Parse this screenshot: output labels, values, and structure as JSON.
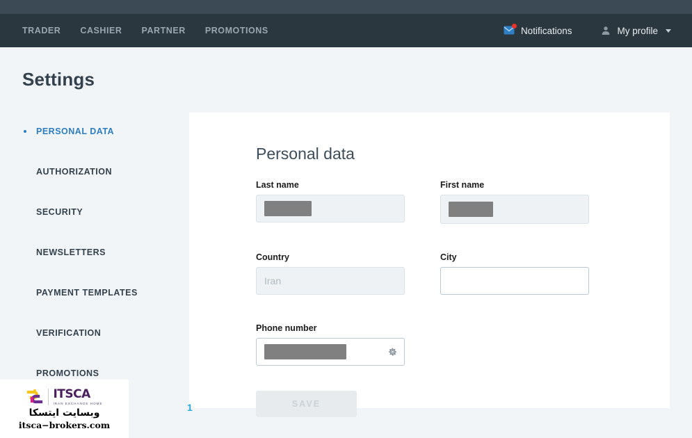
{
  "navbar": {
    "links": [
      {
        "label": "TRADER"
      },
      {
        "label": "CASHIER"
      },
      {
        "label": "PARTNER"
      },
      {
        "label": "PROMOTIONS"
      }
    ],
    "notifications": {
      "label": "Notifications",
      "icon": "envelope-icon",
      "has_unread_badge": true,
      "badge_color": "#e8322a"
    },
    "profile": {
      "label": "My profile",
      "icon": "user-icon",
      "chevron": "chevron-down-icon"
    }
  },
  "page": {
    "title": "Settings"
  },
  "sidebar": {
    "items": [
      {
        "label": "PERSONAL DATA",
        "active": true
      },
      {
        "label": "AUTHORIZATION",
        "active": false
      },
      {
        "label": "SECURITY",
        "active": false
      },
      {
        "label": "NEWSLETTERS",
        "active": false
      },
      {
        "label": "PAYMENT TEMPLATES",
        "active": false
      },
      {
        "label": "VERIFICATION",
        "active": false
      },
      {
        "label": "PROMOTIONS",
        "active": false
      }
    ],
    "active_color": "#2d7cbe"
  },
  "card": {
    "title": "Personal data",
    "fields": {
      "last_name": {
        "label": "Last name",
        "value": "",
        "redacted": true,
        "disabled": true
      },
      "first_name": {
        "label": "First name",
        "value": "",
        "redacted": true,
        "disabled": true
      },
      "country": {
        "label": "Country",
        "value": "Iran",
        "redacted": false,
        "disabled": true
      },
      "city": {
        "label": "City",
        "value": "",
        "redacted": false,
        "disabled": false
      },
      "phone_number": {
        "label": "Phone number",
        "value": "",
        "redacted": true,
        "disabled": false,
        "action_icon": "gear-icon"
      }
    },
    "save_label": "SAVE",
    "save_disabled": true
  },
  "artifact": {
    "text": "1"
  },
  "watermark": {
    "brand": "ITSCA",
    "tagline": "IRAN EXCHANGE HOME",
    "persian_text": "وبسایت ایتسکا",
    "url": "itsca−brokers.com",
    "logo_colors": {
      "yellow": "#f5c518",
      "magenta": "#d6208c",
      "purple": "#6b2d8e"
    }
  }
}
